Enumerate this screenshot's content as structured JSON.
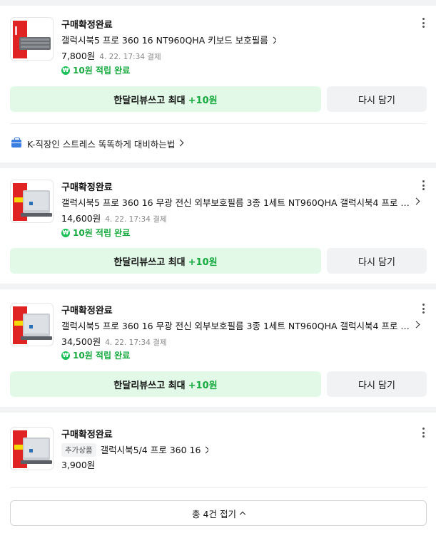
{
  "orders": [
    {
      "status": "구매확정완료",
      "title": "갤럭시북5 프로 360 16 NT960QHA 키보드 보호필름",
      "price": "7,800원",
      "date": "4. 22. 17:34 결제",
      "point_icon": "₩",
      "point": "10원 적립 완료",
      "review_label": "한달리뷰쓰고 최대",
      "review_plus": "+10원",
      "again_label": "다시 담기"
    },
    {
      "status": "구매확정완료",
      "title": "갤럭시북5 프로 360 16 무광 전신 외부보호필름 3종 1세트 NT960QHA 갤럭시북4 프로 …",
      "price": "14,600원",
      "date": "4. 22. 17:34 결제",
      "point_icon": "₩",
      "point": "10원 적립 완료",
      "review_label": "한달리뷰쓰고 최대",
      "review_plus": "+10원",
      "again_label": "다시 담기"
    },
    {
      "status": "구매확정완료",
      "title": "갤럭시북5 프로 360 16 무광 전신 외부보호필름 3종 1세트 NT960QHA 갤럭시북4 프로 …",
      "price": "34,500원",
      "date": "4. 22. 17:34 결제",
      "point_icon": "₩",
      "point": "10원 적립 완료",
      "review_label": "한달리뷰쓰고 최대",
      "review_plus": "+10원",
      "again_label": "다시 담기"
    },
    {
      "status": "구매확정완료",
      "tag": "추가상품",
      "title": "갤럭시북5/4 프로 360 16",
      "price": "3,900원"
    }
  ],
  "promo": {
    "text": "K-직장인 스트레스 똑똑하게 대비하는법",
    "icon": "briefcase-icon"
  },
  "collapse_label": "총 4건 접기",
  "colors": {
    "review_bg": "#e3f9e8",
    "point_green": "#15a93e",
    "page_bg": "#f2f3f5"
  }
}
